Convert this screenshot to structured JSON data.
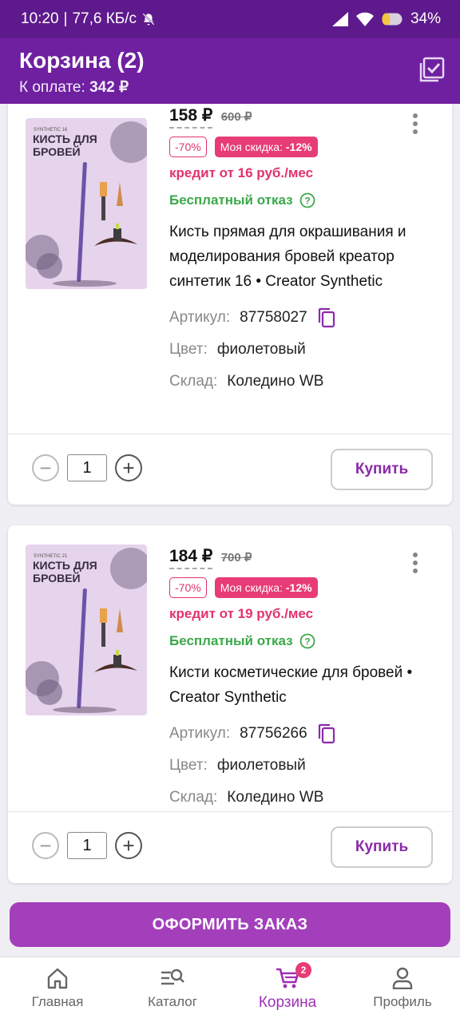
{
  "status_bar": {
    "time": "10:20",
    "speed": "77,6 КБ/с",
    "battery": "34%"
  },
  "header": {
    "title": "Корзина (2)",
    "payment_label": "К оплате:",
    "payment_value": "342 ₽"
  },
  "items": [
    {
      "price": "158 ₽",
      "old_price": "600 ₽",
      "discount": "-70%",
      "my_discount_label": "Моя скидка:",
      "my_discount_value": "-12%",
      "credit": "кредит от 16 руб./мес",
      "refund": "Бесплатный отказ",
      "title": "Кисть прямая для окрашивания и моделирования бровей креатор синтетик 16 • Creator Synthetic",
      "article_label": "Артикул:",
      "article": "87758027",
      "color_label": "Цвет:",
      "color": "фиолетовый",
      "warehouse_label": "Склад:",
      "warehouse": "Коледино WB",
      "quantity": "1",
      "buy_label": "Купить",
      "thumb": {
        "line1": "SYNTHETIC 16",
        "line2": "КИСТЬ ДЛЯ",
        "line3": "БРОВЕЙ"
      }
    },
    {
      "price": "184 ₽",
      "old_price": "700 ₽",
      "discount": "-70%",
      "my_discount_label": "Моя скидка:",
      "my_discount_value": "-12%",
      "credit": "кредит от 19 руб./мес",
      "refund": "Бесплатный отказ",
      "title": "Кисти косметические для бровей • Creator Synthetic",
      "article_label": "Артикул:",
      "article": "87756266",
      "color_label": "Цвет:",
      "color": "фиолетовый",
      "warehouse_label": "Склад:",
      "warehouse": "Коледино WB",
      "quantity": "1",
      "buy_label": "Купить",
      "thumb": {
        "line1": "SYNTHETIC 21",
        "line2": "КИСТЬ ДЛЯ",
        "line3": "БРОВЕЙ"
      }
    }
  ],
  "checkout_label": "ОФОРМИТЬ ЗАКАЗ",
  "nav": {
    "home": "Главная",
    "catalog": "Каталог",
    "cart": "Корзина",
    "cart_badge": "2",
    "profile": "Профиль"
  },
  "colors": {
    "brand": "#6f20a0",
    "accent": "#a33fbb",
    "discount": "#e73c77",
    "success": "#3ba84a"
  }
}
